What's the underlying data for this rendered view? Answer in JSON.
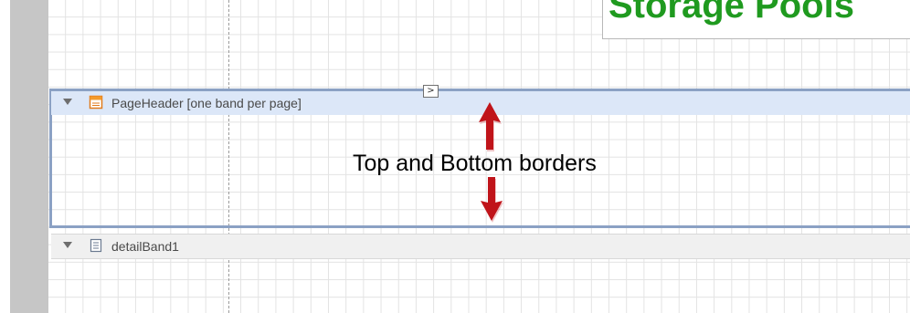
{
  "report_title": {
    "text": "Storage Pools"
  },
  "bands": [
    {
      "label": "PageHeader [one band per page]",
      "icon": "page-header-band-icon"
    },
    {
      "label": "detailBand1",
      "icon": "detail-band-icon"
    }
  ],
  "smart_tag": {
    "glyph": ">"
  },
  "annotation": {
    "text": "Top and Bottom borders"
  },
  "colors": {
    "title_green": "#1f9a1f",
    "selected_band_border": "#8ba1c4",
    "band_header_bg": "#dce7f8",
    "arrow_red": "#c0141a",
    "ruler_gray": "#c6c6c6"
  }
}
